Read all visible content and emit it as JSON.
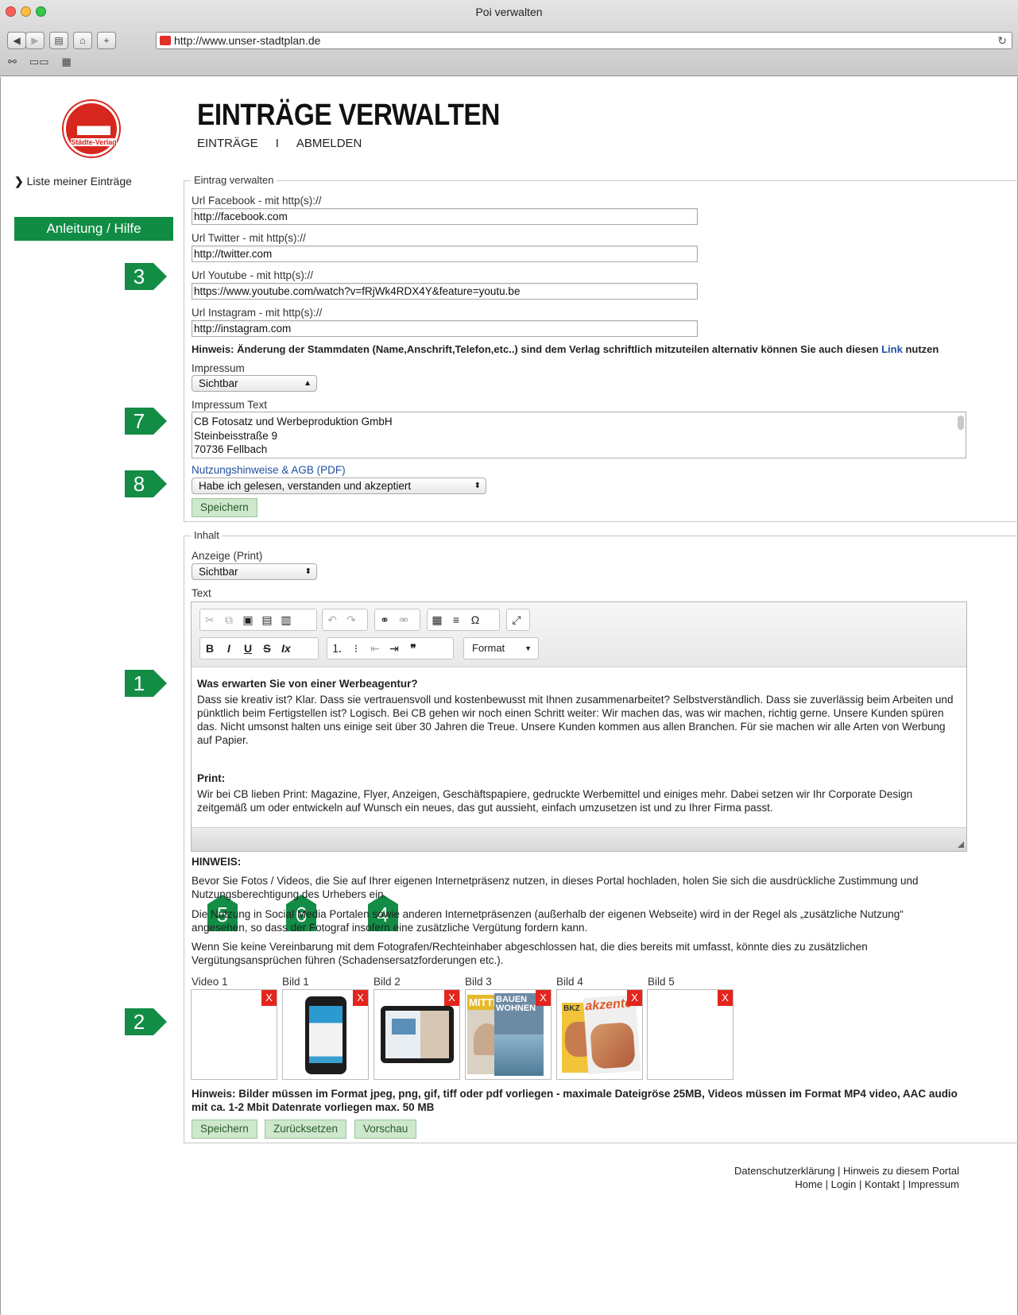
{
  "window": {
    "title": "Poi verwalten",
    "url": "http://www.unser-stadtplan.de"
  },
  "logo": {
    "text": "Städte-Verlag"
  },
  "header": {
    "title": "EINTRÄGE VERWALTEN",
    "nav": [
      "EINTRÄGE",
      "I",
      "ABMELDEN"
    ]
  },
  "sidebar": {
    "link": "Liste meiner Einträge",
    "help_button": "Anleitung / Hilfe"
  },
  "markers": [
    "3",
    "7",
    "8",
    "1",
    "2",
    "5",
    "6",
    "4"
  ],
  "entry": {
    "legend": "Eintrag verwalten",
    "facebook_label": "Url Facebook - mit http(s)://",
    "facebook_value": "http://facebook.com",
    "twitter_label": "Url Twitter - mit http(s)://",
    "twitter_value": "http://twitter.com",
    "youtube_label": "Url Youtube - mit http(s)://",
    "youtube_value": "https://www.youtube.com/watch?v=fRjWk4RDX4Y&feature=youtu.be",
    "instagram_label": "Url Instagram - mit http(s)://",
    "instagram_value": "http://instagram.com",
    "hint_text": "Hinweis: Änderung der Stammdaten (Name,Anschrift,Telefon,etc..) sind dem Verlag schriftlich mitzuteilen alternativ können Sie auch diesen",
    "hint_link": "Link",
    "hint_tail": "nutzen",
    "impressum_label": "Impressum",
    "impressum_value": "Sichtbar",
    "impressum_text_label": "Impressum Text",
    "impressum_text_lines": [
      "CB Fotosatz und Werbeproduktion GmbH",
      "Steinbeisstraße 9",
      "70736 Fellbach"
    ],
    "agb_link": "Nutzungshinweise & AGB (PDF)",
    "agb_value": "Habe ich gelesen, verstanden und akzeptiert",
    "save": "Speichern"
  },
  "content": {
    "legend": "Inhalt",
    "anzeige_label": "Anzeige (Print)",
    "anzeige_value": "Sichtbar",
    "text_label": "Text",
    "format_label": "Format",
    "heading1": "Was erwarten Sie von einer Werbeagentur?",
    "para1": "Dass sie kreativ ist? Klar. Dass sie vertrauensvoll und kostenbewusst mit Ihnen zusammenarbeitet? Selbstverständlich. Dass sie zuverlässig beim Arbeiten und pünktlich beim Fertigstellen ist? Logisch. Bei CB gehen wir noch einen Schritt weiter: Wir machen das, was wir machen, richtig gerne. Unsere Kunden spüren das. Nicht umsonst halten uns einige seit über 30 Jahren die Treue. Unsere Kunden kommen aus allen Branchen. Für sie machen wir alle Arten von Werbung auf Papier.",
    "heading2": "Print:",
    "para2": "Wir bei CB lieben Print: Magazine, Flyer, Anzeigen, Geschäftspapiere, gedruckte Werbemittel und einiges mehr. Dabei setzen wir Ihr Corporate Design zeitgemäß um oder entwickeln auf Wunsch ein neues, das gut aussieht, einfach umzusetzen ist und zu Ihrer Firma passt.",
    "hinweis_title": "HINWEIS:",
    "hinweis1": "Bevor Sie Fotos / Videos, die Sie auf Ihrer eigenen Internetpräsenz nutzen, in dieses Portal hochladen, holen Sie sich die ausdrückliche Zustimmung und Nutzungsberechtigung des Urhebers ein.",
    "hinweis2": "Die Nutzung in Social Media Portalen sowie anderen Internetpräsenzen (außerhalb der eigenen Webseite) wird in der Regel als „zusätzliche Nutzung“ angesehen, so dass der Fotograf insofern eine zusätzliche Vergütung fordern kann.",
    "hinweis3": "Wenn Sie keine Vereinbarung mit dem Fotografen/Rechteinhaber abgeschlossen hat, die dies bereits mit umfasst, könnte dies zu zusätzlichen Vergütungsansprüchen führen (Schadensersatzforderungen etc.).",
    "media": [
      {
        "label": "Video 1",
        "x": "X"
      },
      {
        "label": "Bild 1",
        "x": "X"
      },
      {
        "label": "Bild 2",
        "x": "X"
      },
      {
        "label": "Bild 3",
        "x": "X"
      },
      {
        "label": "Bild 4",
        "x": "X"
      },
      {
        "label": "Bild 5",
        "x": "X"
      }
    ],
    "thumb_text": {
      "mitte": "MITTE",
      "bauen": "BAUEN",
      "wohnen": "WOHNEN",
      "akzente": "akzente",
      "bkz": "BKZ"
    },
    "format_hint": "Hinweis: Bilder müssen im Format jpeg, png, gif, tiff oder pdf vorliegen - maximale Dateigröse 25MB, Videos müssen im Format MP4 video, AAC audio mit ca. 1-2 Mbit Datenrate vorliegen max. 50 MB",
    "save": "Speichern",
    "reset": "Zurücksetzen",
    "preview": "Vorschau"
  },
  "footer": {
    "line1": "Datenschutzerklärung | Hinweis zu diesem Portal",
    "line2": "Home | Login | Kontakt | Impressum"
  },
  "colors": {
    "green": "#118c44",
    "red": "#e3251d",
    "link": "#1f4fa0"
  }
}
